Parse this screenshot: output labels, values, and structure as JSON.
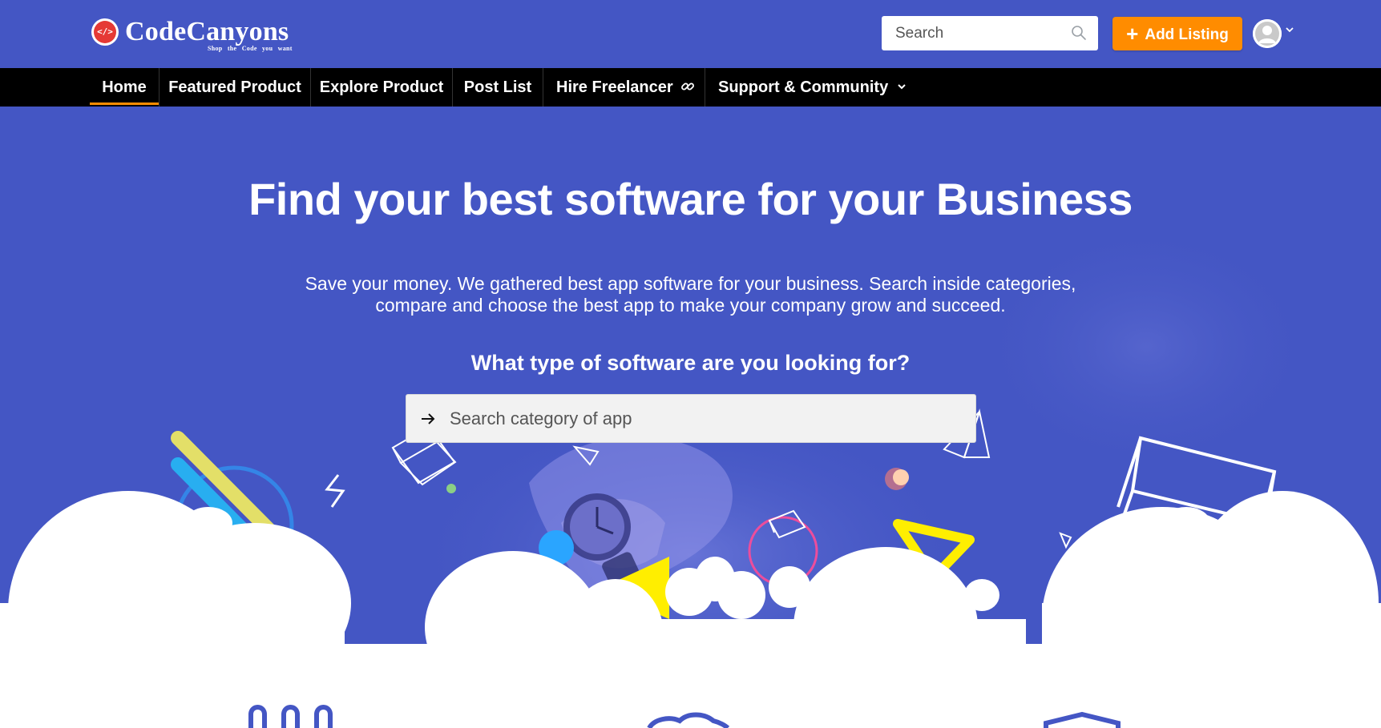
{
  "brand": {
    "name": "CodeCanyons",
    "tagline": "Shop the Code you want",
    "badge_symbol": "</>"
  },
  "header": {
    "search_placeholder": "Search",
    "add_listing_label": "Add Listing",
    "add_listing_icon": "plus-icon"
  },
  "nav": {
    "items": [
      {
        "label": "Home",
        "active": true
      },
      {
        "label": "Featured Product"
      },
      {
        "label": "Explore Product"
      },
      {
        "label": "Post List"
      },
      {
        "label": "Hire Freelancer",
        "icon": "link-icon"
      },
      {
        "label": "Support & Community",
        "icon": "chevron-down-icon"
      }
    ]
  },
  "hero": {
    "title": "Find your best software for your Business",
    "subtitle_line1": "Save your money. We gathered best app software for your business. Search inside categories,",
    "subtitle_line2": "compare and choose the best app to make your company grow and succeed.",
    "question": "What type of software are you looking for?",
    "search_placeholder": "Search category of app"
  },
  "colors": {
    "primary": "#4456c4",
    "accent": "#ff8c00",
    "nav_bg": "#000000",
    "white": "#ffffff"
  }
}
